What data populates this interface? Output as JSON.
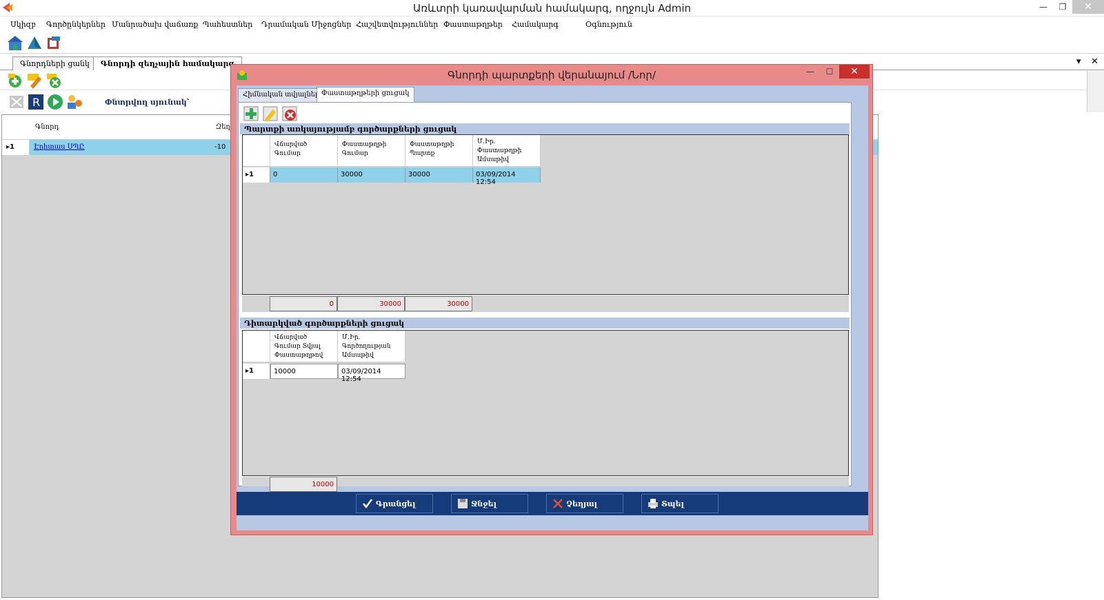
{
  "window": {
    "title": "Առևտրի կառավարման համակարգ, ողջույն Admin"
  },
  "menu": [
    "Սկիզբ",
    "Գործընկերներ",
    "Մանրածախ վաճառք",
    "Պահեստներ",
    "Դրամական Միջոցներ",
    "Հաշվետվություններ",
    "Փաստաթղթեր",
    "Համակարգ",
    "Օգնություն"
  ],
  "tabs": {
    "list": "Գնորդների ցանկ",
    "active": "Գնորդի զեղչային համակարգ"
  },
  "search": {
    "label": "Փնտրվող սյունակ՝"
  },
  "main_grid": {
    "col_buyer": "Գնորդ",
    "col_two": "Զեղ",
    "row_num": "1",
    "buyer": "Էրիտաս ՍՊԸ",
    "value": "-10"
  },
  "dialog": {
    "title": "Գնորդի պարտքերի վերանայում /Նոր/",
    "tab_general": "Հիմնական տվյալներ",
    "tab_docs": "Փաստաթղթերի ցուցակ",
    "section1": "Պարտքի առկայությամբ գործարքների ցուցակ",
    "section2": "Դիտարկված գործարքների ցուցակ",
    "grid1": {
      "headers": [
        "Վճարված Գումար",
        "Փաստաթղթի Գումար",
        "Փաստաթղթի Պարտք",
        "Մ.Իր. Փաստաթղթի Ամսաթիվ"
      ],
      "row_num": "1",
      "row": [
        "0",
        "30000",
        "30000",
        "03/09/2014 12:54"
      ],
      "totals": [
        "0",
        "30000",
        "30000"
      ]
    },
    "grid2": {
      "headers": [
        "Վճարված Գումար Տվյալ Փաստաթղթով",
        "Մ.Իր. Գործողության Ամսաթիվ"
      ],
      "row_num": "1",
      "row": [
        "10000",
        "03/09/2014 12:54"
      ],
      "totals": [
        "10000"
      ]
    },
    "buttons": {
      "save": "Գրանցել",
      "delete": "Ջնջել",
      "cancel": "Չեղյալ",
      "print": "Տպել"
    }
  }
}
